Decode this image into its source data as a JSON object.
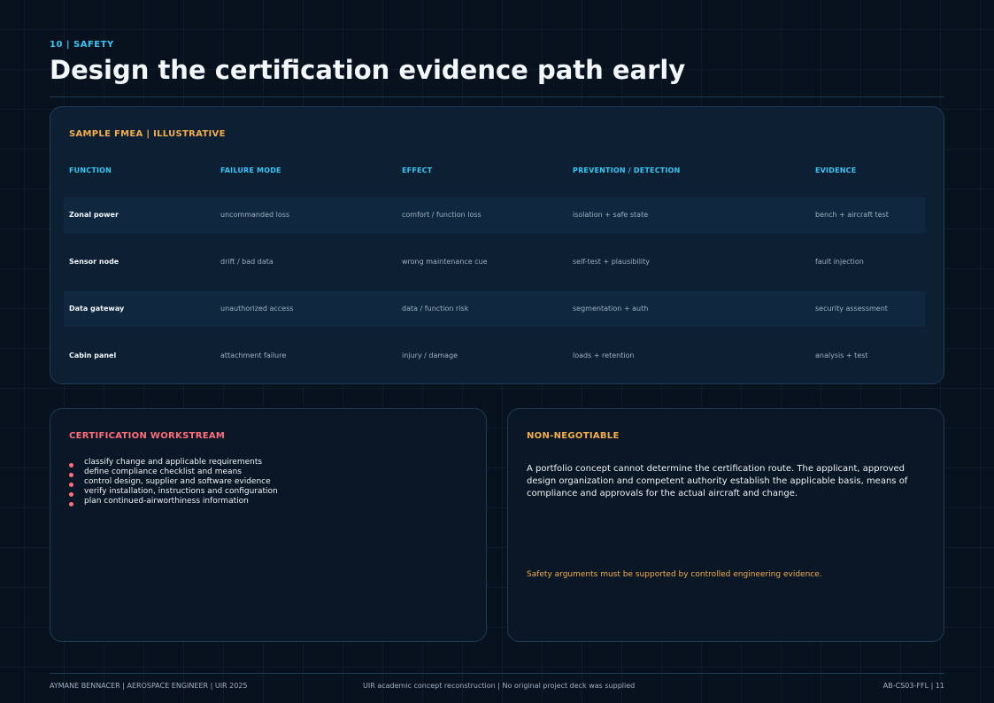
{
  "header": {
    "kicker": "10 | SAFETY",
    "title": "Design the certification evidence path early"
  },
  "fmea": {
    "title": "SAMPLE FMEA | ILLUSTRATIVE",
    "columns": [
      "FUNCTION",
      "FAILURE MODE",
      "EFFECT",
      "PREVENTION / DETECTION",
      "EVIDENCE"
    ],
    "rows": [
      [
        "Zonal power",
        "uncommanded loss",
        "comfort / function loss",
        "isolation + safe state",
        "bench + aircraft test"
      ],
      [
        "Sensor node",
        "drift / bad data",
        "wrong maintenance cue",
        "self-test + plausibility",
        "fault injection"
      ],
      [
        "Data gateway",
        "unauthorized access",
        "data / function risk",
        "segmentation + auth",
        "security assessment"
      ],
      [
        "Cabin panel",
        "attachment failure",
        "injury / damage",
        "loads + retention",
        "analysis + test"
      ]
    ]
  },
  "certification": {
    "title": "CERTIFICATION WORKSTREAM",
    "items": [
      "classify change and applicable requirements",
      "define compliance checklist and means",
      "control design, supplier and software evidence",
      "verify installation, instructions and configuration",
      "plan continued-airworthiness information"
    ]
  },
  "non_negotiable": {
    "title": "NON-NEGOTIABLE",
    "body": "A portfolio concept cannot determine the certification route. The applicant, approved design organization and competent authority establish the applicable basis, means of compliance and approvals for the actual aircraft and change.",
    "note": "Safety arguments must be supported by controlled engineering evidence."
  },
  "footer": {
    "left": "AYMANE BENNACER | AEROSPACE ENGINEER | UIR 2025",
    "center": "UIR academic concept reconstruction | No original project deck was supplied",
    "right": "AB-CS03-FFL | 11"
  },
  "colors": {
    "background": "#08121f",
    "accent_cyan": "#38c6f4",
    "accent_amber": "#f4ae4c",
    "accent_coral": "#ff6e7a"
  }
}
